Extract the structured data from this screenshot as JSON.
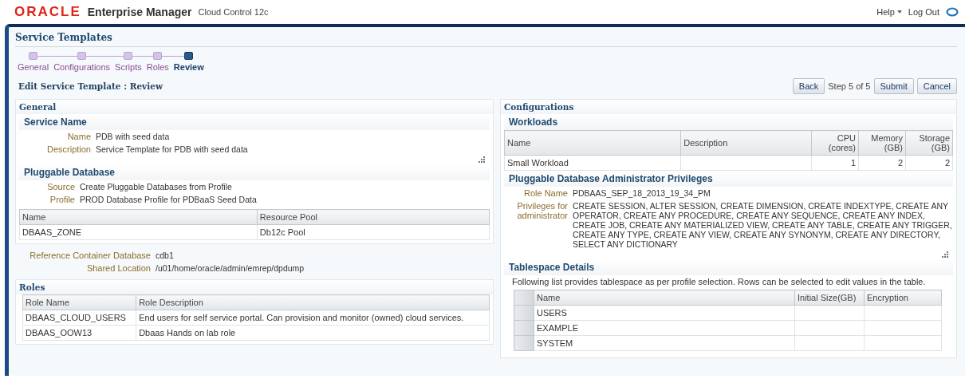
{
  "header": {
    "logo": "ORACLE",
    "product": "Enterprise Manager",
    "subtitle": "Cloud Control 12c",
    "links": [
      {
        "label": "Help",
        "kind": "menu"
      },
      {
        "label": "Log Out",
        "kind": "link"
      }
    ]
  },
  "page": {
    "title": "Service Templates"
  },
  "train": [
    {
      "label": "General",
      "selected": false
    },
    {
      "label": "Configurations",
      "selected": false
    },
    {
      "label": "Scripts",
      "selected": false
    },
    {
      "label": "Roles",
      "selected": false
    },
    {
      "label": "Review",
      "selected": true
    }
  ],
  "form": {
    "title": "Edit Service Template : Review",
    "actions": [
      {
        "label": "Back",
        "kind": "button"
      },
      {
        "label": "Step 5 of 5",
        "kind": "text"
      },
      {
        "label": "Submit",
        "kind": "button"
      },
      {
        "label": "Cancel",
        "kind": "button"
      }
    ]
  },
  "general": {
    "title": "General",
    "service_name": {
      "title": "Service Name",
      "fields": [
        {
          "label": "Name",
          "value": "PDB with seed data"
        },
        {
          "label": "Description",
          "value": "Service Template for PDB with seed data"
        }
      ]
    },
    "pluggable": {
      "title": "Pluggable Database",
      "fields": [
        {
          "label": "Source",
          "value": "Create Pluggable Databases from Profile"
        },
        {
          "label": "Profile",
          "value": "PROD Database Profile for PDBaaS Seed Data"
        }
      ]
    },
    "pool_table": {
      "columns": [
        "Name",
        "Resource Pool"
      ],
      "rows": [
        [
          "DBAAS_ZONE",
          "Db12c Pool"
        ]
      ]
    },
    "fields": [
      {
        "label": "Reference Container Database",
        "value": "cdb1"
      },
      {
        "label": "Shared Location",
        "value": "/u01/home/oracle/admin/emrep/dpdump"
      }
    ],
    "roles": {
      "title": "Roles",
      "columns": [
        "Role Name",
        "Role Description"
      ],
      "rows": [
        [
          "DBAAS_CLOUD_USERS",
          "End users for self service portal. Can provision and monitor (owned) cloud services."
        ],
        [
          "DBAAS_OOW13",
          "Dbaas Hands on lab role"
        ]
      ]
    }
  },
  "configurations": {
    "title": "Configurations",
    "workloads": {
      "title": "Workloads",
      "columns": [
        {
          "label": "Name",
          "numeric": false
        },
        {
          "label": "Description",
          "numeric": false
        },
        {
          "label": "CPU (cores)",
          "numeric": true
        },
        {
          "label": "Memory (GB)",
          "numeric": true
        },
        {
          "label": "Storage (GB)",
          "numeric": true
        }
      ],
      "rows": [
        [
          "Small Workload",
          "",
          "1",
          "2",
          "2"
        ]
      ]
    },
    "privileges": {
      "title": "Pluggable Database Administrator Privileges",
      "fields": [
        {
          "label": "Role Name",
          "value": "PDBAAS_SEP_18_2013_19_34_PM"
        },
        {
          "label": "Privileges for administrator",
          "value": "CREATE SESSION, ALTER SESSION, CREATE DIMENSION, CREATE INDEXTYPE, CREATE ANY OPERATOR, CREATE ANY PROCEDURE, CREATE ANY SEQUENCE, CREATE ANY INDEX, CREATE JOB, CREATE ANY MATERIALIZED VIEW, CREATE ANY TABLE, CREATE ANY TRIGGER, CREATE ANY TYPE, CREATE ANY VIEW, CREATE ANY SYNONYM, CREATE ANY DIRECTORY, SELECT ANY DICTIONARY"
        }
      ]
    },
    "tablespace": {
      "title": "Tablespace Details",
      "note": "Following list provides tablespace as per profile selection. Rows can be selected to edit values in the table.",
      "columns": [
        "Name",
        "Initial Size(GB)",
        "Encryption"
      ],
      "rows": [
        [
          "USERS",
          "",
          ""
        ],
        [
          "EXAMPLE",
          "",
          ""
        ],
        [
          "SYSTEM",
          "",
          ""
        ]
      ]
    }
  }
}
